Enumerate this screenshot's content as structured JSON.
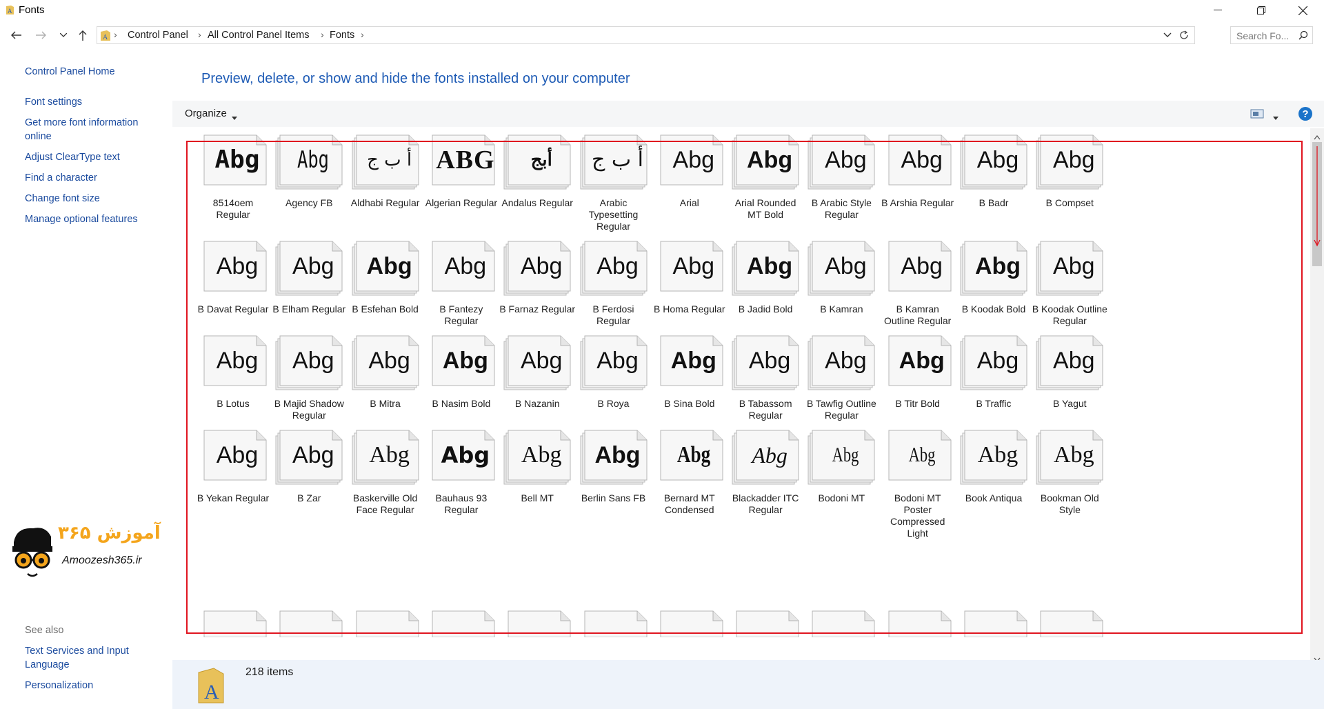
{
  "window": {
    "title": "Fonts",
    "minimize_icon": "minimize-icon",
    "maximize_icon": "restore-icon",
    "close_icon": "close-icon"
  },
  "address": {
    "crumbs": [
      "Control Panel",
      "All Control Panel Items",
      "Fonts"
    ],
    "search_placeholder": "Search Fo..."
  },
  "sidebar": {
    "links": [
      "Control Panel Home",
      "Font settings",
      "Get more font information online",
      "Adjust ClearType text",
      "Find a character",
      "Change font size",
      "Manage optional features"
    ],
    "see_also_label": "See also",
    "see_also_links": [
      "Text Services and Input Language",
      "Personalization"
    ],
    "logo_text": "آموزش ۳۶۵",
    "logo_subtext": "Amoozesh365.ir"
  },
  "main": {
    "heading": "Preview, delete, or show and hide the fonts installed on your computer",
    "organize_label": "Organize",
    "fonts": [
      {
        "name": "8514oem Regular",
        "sample": "Abg"
      },
      {
        "name": "Agency FB",
        "sample": "Abg"
      },
      {
        "name": "Aldhabi Regular",
        "sample": "أ ب ج"
      },
      {
        "name": "Algerian Regular",
        "sample": "ABG"
      },
      {
        "name": "Andalus Regular",
        "sample": "أبج"
      },
      {
        "name": "Arabic Typesetting Regular",
        "sample": "أ ب ج"
      },
      {
        "name": "Arial",
        "sample": "Abg"
      },
      {
        "name": "Arial Rounded MT Bold",
        "sample": "Abg"
      },
      {
        "name": "B Arabic Style Regular",
        "sample": "Abg"
      },
      {
        "name": "B Arshia Regular",
        "sample": "Abg"
      },
      {
        "name": "B Badr",
        "sample": "Abg"
      },
      {
        "name": "B Compset",
        "sample": "Abg"
      },
      {
        "name": "B Davat Regular",
        "sample": "Abg"
      },
      {
        "name": "B Elham Regular",
        "sample": "Abg"
      },
      {
        "name": "B Esfehan Bold",
        "sample": "Abg"
      },
      {
        "name": "B Fantezy Regular",
        "sample": "Abg"
      },
      {
        "name": "B Farnaz Regular",
        "sample": "Abg"
      },
      {
        "name": "B Ferdosi Regular",
        "sample": "Abg"
      },
      {
        "name": "B Homa Regular",
        "sample": "Abg"
      },
      {
        "name": "B Jadid Bold",
        "sample": "Abg"
      },
      {
        "name": "B Kamran",
        "sample": "Abg"
      },
      {
        "name": "B Kamran Outline Regular",
        "sample": "Abg"
      },
      {
        "name": "B Koodak Bold",
        "sample": "Abg"
      },
      {
        "name": "B Koodak Outline Regular",
        "sample": "Abg"
      },
      {
        "name": "B Lotus",
        "sample": "Abg"
      },
      {
        "name": "B Majid Shadow Regular",
        "sample": "Abg"
      },
      {
        "name": "B Mitra",
        "sample": "Abg"
      },
      {
        "name": "B Nasim Bold",
        "sample": "Abg"
      },
      {
        "name": "B Nazanin",
        "sample": "Abg"
      },
      {
        "name": "B Roya",
        "sample": "Abg"
      },
      {
        "name": "B Sina Bold",
        "sample": "Abg"
      },
      {
        "name": "B Tabassom Regular",
        "sample": "Abg"
      },
      {
        "name": "B Tawfig Outline Regular",
        "sample": "Abg"
      },
      {
        "name": "B Titr Bold",
        "sample": "Abg"
      },
      {
        "name": "B Traffic",
        "sample": "Abg"
      },
      {
        "name": "B Yagut",
        "sample": "Abg"
      },
      {
        "name": "B Yekan Regular",
        "sample": "Abg"
      },
      {
        "name": "B Zar",
        "sample": "Abg"
      },
      {
        "name": "Baskerville Old Face Regular",
        "sample": "Abg"
      },
      {
        "name": "Bauhaus 93 Regular",
        "sample": "Abg"
      },
      {
        "name": "Bell MT",
        "sample": "Abg"
      },
      {
        "name": "Berlin Sans FB",
        "sample": "Abg"
      },
      {
        "name": "Bernard MT Condensed",
        "sample": "Abg"
      },
      {
        "name": "Blackadder ITC Regular",
        "sample": "Abg"
      },
      {
        "name": "Bodoni MT",
        "sample": "Abg"
      },
      {
        "name": "Bodoni MT Poster Compressed Light",
        "sample": "Abg"
      },
      {
        "name": "Book Antiqua",
        "sample": "Abg"
      },
      {
        "name": "Bookman Old Style",
        "sample": "Abg"
      }
    ]
  },
  "status": {
    "item_count": "218 items"
  },
  "colors": {
    "link": "#1a4a9e",
    "heading": "#1e5bb5",
    "highlight_border": "#e0141f"
  }
}
